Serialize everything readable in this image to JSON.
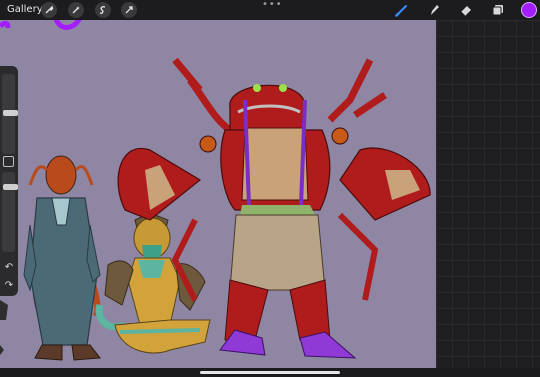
{
  "topbar": {
    "gallery_label": "Gallery",
    "actions": [
      "wrench-icon",
      "magic-wand-icon",
      "selection-icon",
      "transform-arrow-icon"
    ],
    "tools": [
      "brush-icon",
      "smudge-icon",
      "eraser-icon",
      "layers-icon"
    ],
    "active_tool": "brush-icon",
    "current_color": "#a31dff"
  },
  "sidebar": {
    "brush_size_level": 0.45,
    "opacity_level": 0.6,
    "undo_icon": "undo-icon",
    "redo_icon": "redo-icon"
  },
  "canvas": {
    "background_color": "#8e86a3"
  }
}
